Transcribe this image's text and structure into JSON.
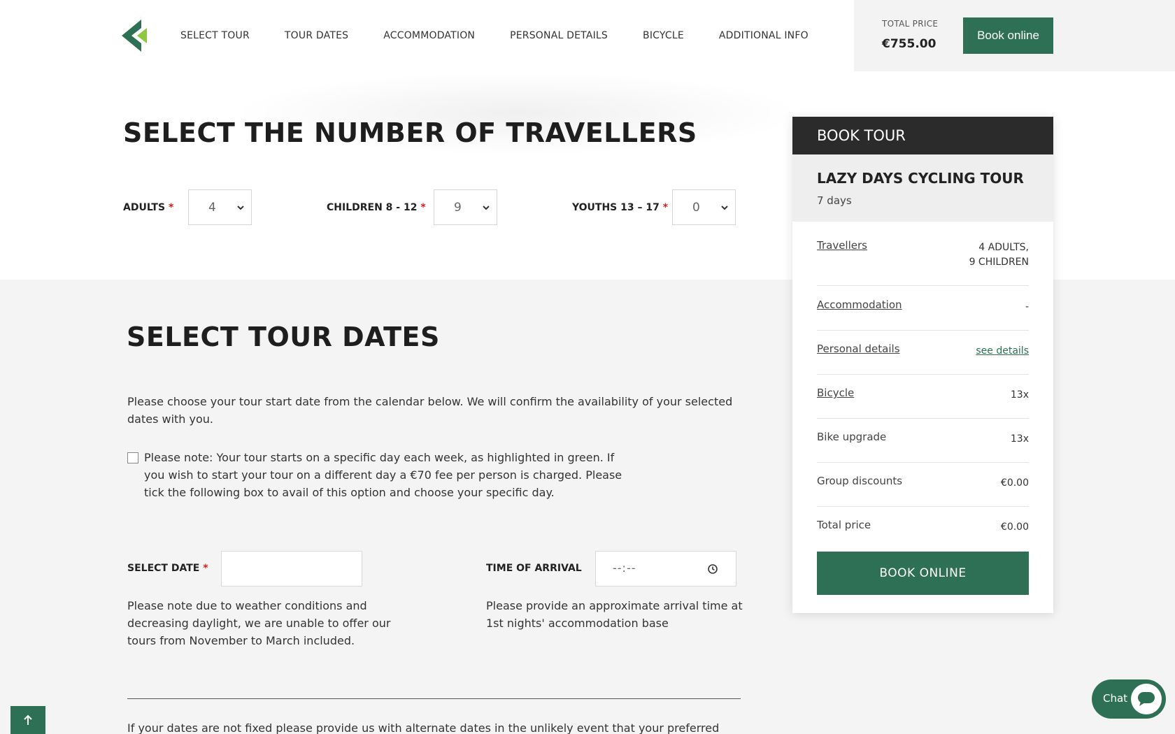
{
  "header": {
    "nav": [
      "SELECT TOUR",
      "TOUR DATES",
      "ACCOMMODATION",
      "PERSONAL DETAILS",
      "BICYCLE",
      "ADDITIONAL INFO"
    ],
    "total_price_label": "TOTAL PRICE",
    "total_price_value": "€755.00",
    "book_online_label": "Book online"
  },
  "travellers": {
    "title": "SELECT THE NUMBER OF TRAVELLERS",
    "adults_label": "ADULTS",
    "adults_value": "4",
    "children_label": "CHILDREN 8 - 12",
    "children_value": "9",
    "youths_label": "YOUTHS 13 – 17",
    "youths_value": "0",
    "required_mark": "*"
  },
  "dates": {
    "title": "SELECT TOUR DATES",
    "intro": "Please choose your tour start date from the calendar below. We will confirm the availability of your selected dates with you.",
    "note": "Please note: Your tour starts on a specific day each week, as highlighted in green. If you wish to start your tour on a different day a €70 fee per person is charged. Please tick the following box to avail of this option and choose your specific day.",
    "select_date_label": "SELECT DATE",
    "select_date_value": "",
    "time_label": "TIME OF ARRIVAL",
    "time_placeholder": "--:--",
    "date_note": "Please note due to weather conditions and decreasing daylight, we are unable to offer our tours from November to March included.",
    "time_note": "Please provide an approximate arrival time at 1st nights' accommodation base",
    "alternate_text": "If your dates are not fixed please provide us with alternate dates in the unlikely event that your preferred"
  },
  "card": {
    "header": "BOOK TOUR",
    "tour_name": "LAZY DAYS CYCLING TOUR",
    "tour_days": "7 days",
    "rows": [
      {
        "label": "Travellers",
        "value_line1": "4 ADULTS,",
        "value_line2": "9 CHILDREN"
      },
      {
        "label": "Accommodation",
        "value": "-"
      },
      {
        "label": "Personal details",
        "value": "see details"
      },
      {
        "label": "Bicycle",
        "value": "13x"
      },
      {
        "label": "Bike upgrade",
        "value": "13x"
      },
      {
        "label": "Group discounts",
        "value": "€0.00"
      },
      {
        "label": "Total price",
        "value": "€0.00"
      }
    ],
    "book_online_label": "BOOK ONLINE"
  },
  "chat": {
    "label": "Chat"
  },
  "colors": {
    "brand_green": "#2e7055",
    "dark": "#2b2b2b",
    "required": "#d02020"
  },
  "icons": [
    "logo-icon",
    "chevron-down-icon",
    "clock-icon",
    "arrow-up-icon",
    "chat-bubble-icon"
  ]
}
